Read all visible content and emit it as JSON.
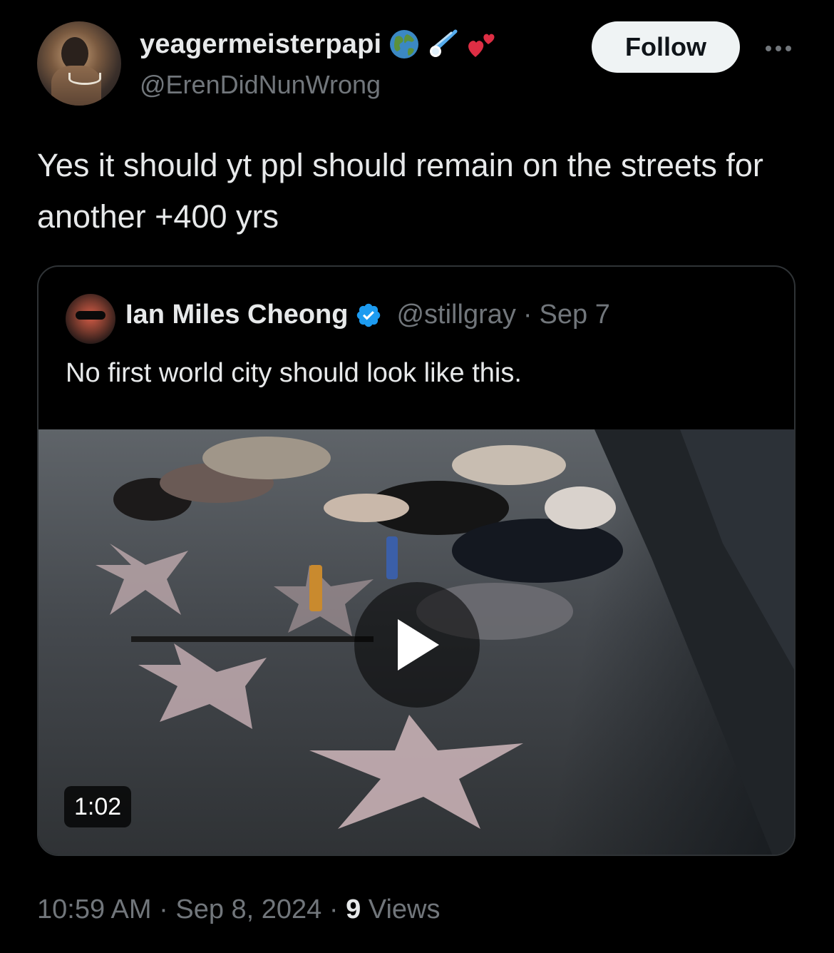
{
  "author": {
    "display_name": "yeagermeisterpapi",
    "handle": "@ErenDidNunWrong",
    "emojis": [
      "globe-emoji",
      "comet-emoji",
      "two-hearts-emoji"
    ]
  },
  "follow_label": "Follow",
  "more_icon": "more-horizontal-icon",
  "tweet": {
    "text": "Yes it should yt ppl should remain on the streets for another +400 yrs"
  },
  "quoted": {
    "display_name": "Ian Miles Cheong",
    "verified": true,
    "handle": "@stillgray",
    "separator": "·",
    "date": "Sep 7",
    "text": "No first world city should look like this.",
    "video_duration": "1:02"
  },
  "meta": {
    "time": "10:59 AM",
    "sep1": "·",
    "date": "Sep 8, 2024",
    "sep2": "·",
    "views_count": "9",
    "views_label": "Views"
  },
  "colors": {
    "background": "#000000",
    "text_primary": "#e7e9ea",
    "text_secondary": "#71767b",
    "verified_blue": "#1d9bf0",
    "border": "#2f3336"
  }
}
